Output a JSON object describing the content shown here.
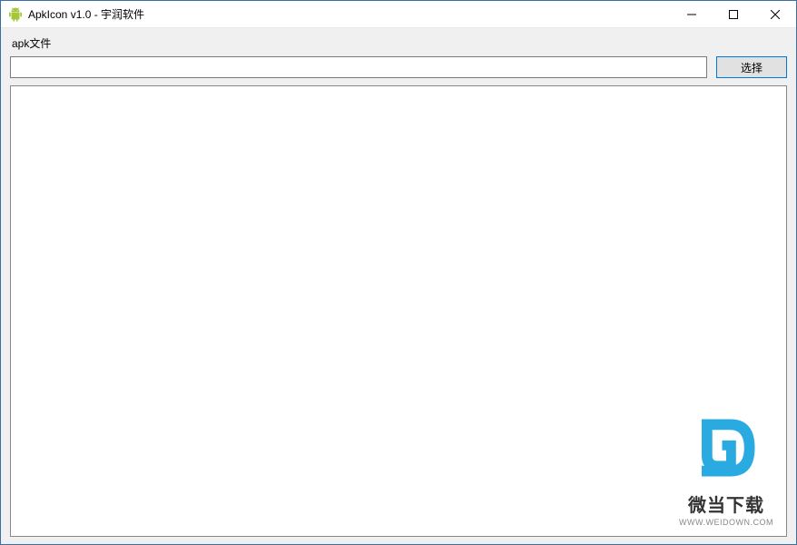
{
  "window": {
    "title": "ApkIcon v1.0 - 宇润软件"
  },
  "form": {
    "file_label": "apk文件",
    "path_value": "",
    "path_placeholder": "",
    "select_button": "选择"
  },
  "watermark": {
    "main_text": "微当下载",
    "sub_text": "WWW.WEIDOWN.COM"
  }
}
